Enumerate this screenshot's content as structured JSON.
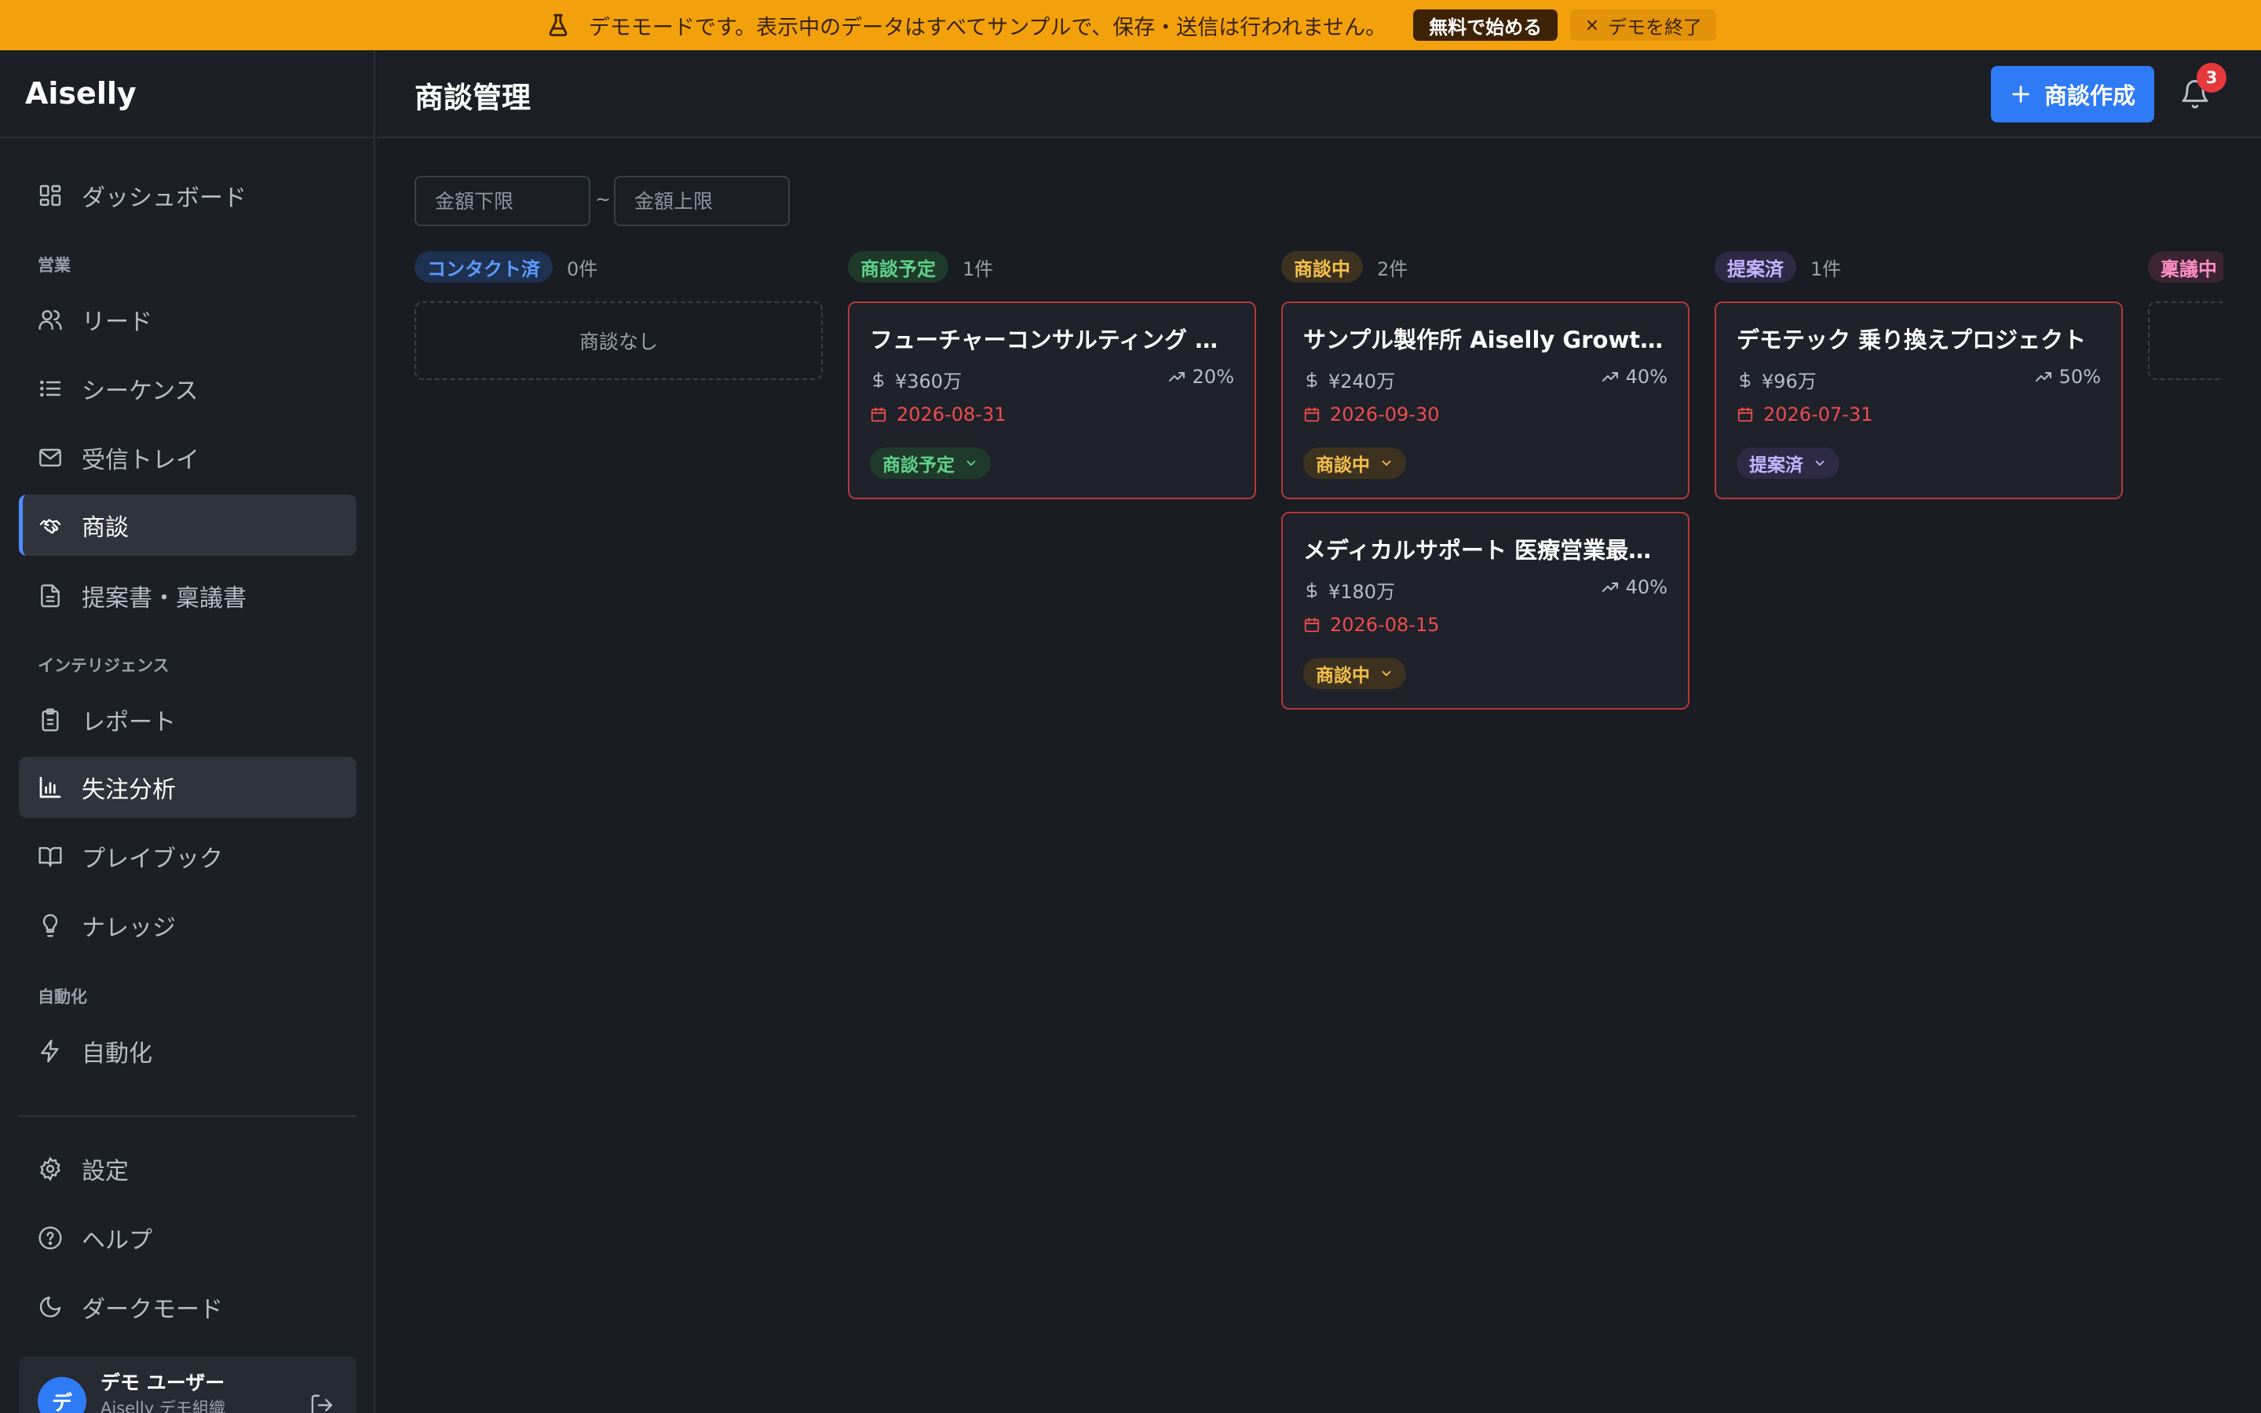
{
  "banner": {
    "message": "デモモードです。表示中のデータはすべてサンプルで、保存・送信は行われません。",
    "cta_label": "無料で始める",
    "exit_label": "デモを終了",
    "icon": "flask-icon",
    "color": "#f2a10d"
  },
  "sidebar": {
    "brand": "Aiselly",
    "sections": {
      "sales": "営業",
      "intelligence": "インテリジェンス",
      "automation": "自動化"
    },
    "items": {
      "dashboard": {
        "label": "ダッシュボード",
        "icon": "grid-icon"
      },
      "leads": {
        "label": "リード",
        "icon": "users-icon"
      },
      "sequences": {
        "label": "シーケンス",
        "icon": "list-icon"
      },
      "inbox": {
        "label": "受信トレイ",
        "icon": "mail-icon"
      },
      "deals": {
        "label": "商談",
        "icon": "handshake-icon",
        "active": true
      },
      "proposals": {
        "label": "提案書・稟議書",
        "icon": "document-icon"
      },
      "reports": {
        "label": "レポート",
        "icon": "clipboard-icon"
      },
      "loss_analysis": {
        "label": "失注分析",
        "icon": "bar-chart-icon",
        "highlighted": true
      },
      "playbook": {
        "label": "プレイブック",
        "icon": "book-icon"
      },
      "knowledge": {
        "label": "ナレッジ",
        "icon": "lightbulb-icon"
      },
      "automation": {
        "label": "自動化",
        "icon": "bolt-icon"
      },
      "settings": {
        "label": "設定",
        "icon": "gear-icon"
      },
      "help": {
        "label": "ヘルプ",
        "icon": "help-icon"
      },
      "dark_mode": {
        "label": "ダークモード",
        "icon": "moon-icon"
      }
    },
    "user": {
      "avatar_initial": "デ",
      "name": "デモ ユーザー",
      "org": "Aiselly デモ組織"
    }
  },
  "header": {
    "title": "商談管理",
    "create_label": "商談作成",
    "notification_count": "3",
    "accent": "#2f7bf5"
  },
  "filters": {
    "amount_min_placeholder": "金額下限",
    "amount_max_placeholder": "金額上限",
    "separator": "~"
  },
  "board": {
    "columns": [
      {
        "name": "コンタクト済",
        "count": "0件",
        "pill_bg": "#1f3150",
        "pill_fg": "#5b9bff",
        "empty_label": "商談なし",
        "cards": []
      },
      {
        "name": "商談予定",
        "count": "1件",
        "pill_bg": "#1f3a2b",
        "pill_fg": "#5fd38a",
        "cards": [
          {
            "title": "フューチャーコンサルティング 全社導入",
            "amount": "¥360万",
            "probability": "20%",
            "date": "2026-08-31",
            "stage": "商談予定"
          }
        ]
      },
      {
        "name": "商談中",
        "count": "2件",
        "pill_bg": "#3d3220",
        "pill_fg": "#f5c04a",
        "cards": [
          {
            "title": "サンプル製作所 Aiselly Growth導入",
            "amount": "¥240万",
            "probability": "40%",
            "date": "2026-09-30",
            "stage": "商談中"
          },
          {
            "title": "メディカルサポート 医療営業最適化",
            "amount": "¥180万",
            "probability": "40%",
            "date": "2026-08-15",
            "stage": "商談中"
          }
        ]
      },
      {
        "name": "提案済",
        "count": "1件",
        "pill_bg": "#2e2a45",
        "pill_fg": "#c3b5ff",
        "cards": [
          {
            "title": "デモテック 乗り換えプロジェクト",
            "amount": "¥96万",
            "probability": "50%",
            "date": "2026-07-31",
            "stage": "提案済"
          }
        ]
      },
      {
        "name": "稟議中",
        "pill_bg": "#3d2434",
        "pill_fg": "#ff8fc4",
        "cards": []
      }
    ],
    "overdue_color": "#ef4c4c"
  }
}
